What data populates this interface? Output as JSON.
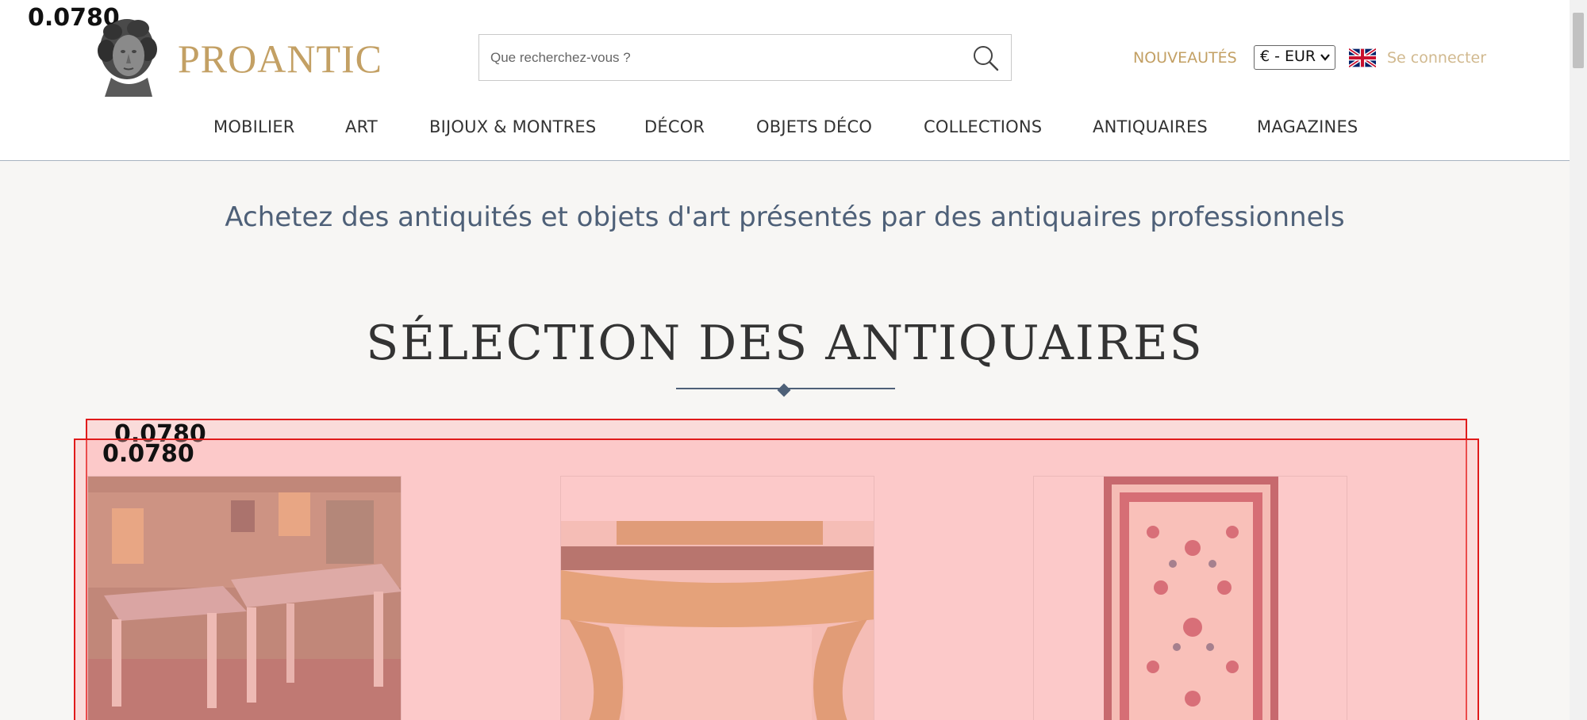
{
  "debug_labels": {
    "header": "0.0780",
    "box_a": "0.0780",
    "box_b": "0.0780"
  },
  "header": {
    "brand": "PROANTIC",
    "logo_icon": "classical-bust-icon",
    "search": {
      "placeholder": "Que recherchez-vous ?",
      "value": "",
      "icon": "search-icon"
    },
    "new_link": "NOUVEAUTÉS",
    "currency": "€ - EUR",
    "language_flag": "uk-flag-icon",
    "login": "Se connecter"
  },
  "nav": {
    "items": [
      {
        "label": "MOBILIER"
      },
      {
        "label": "ART"
      },
      {
        "label": "BIJOUX & MONTRES"
      },
      {
        "label": "DÉCOR"
      },
      {
        "label": "OBJETS DÉCO"
      },
      {
        "label": "COLLECTIONS"
      },
      {
        "label": "ANTIQUAIRES"
      },
      {
        "label": "MAGAZINES"
      }
    ]
  },
  "main": {
    "tagline": "Achetez des antiquités et objets d'art présentés par des antiquaires professionnels",
    "section_title": "SÉLECTION DES ANTIQUAIRES",
    "cards": [
      {
        "name": "stools-photo"
      },
      {
        "name": "gilded-console-photo"
      },
      {
        "name": "persian-rug-photo"
      }
    ]
  },
  "colors": {
    "brand_gold": "#c3a064",
    "nav_text": "#333333",
    "tagline_blue": "#4e6078",
    "overlay_red": "#e01b1b"
  }
}
